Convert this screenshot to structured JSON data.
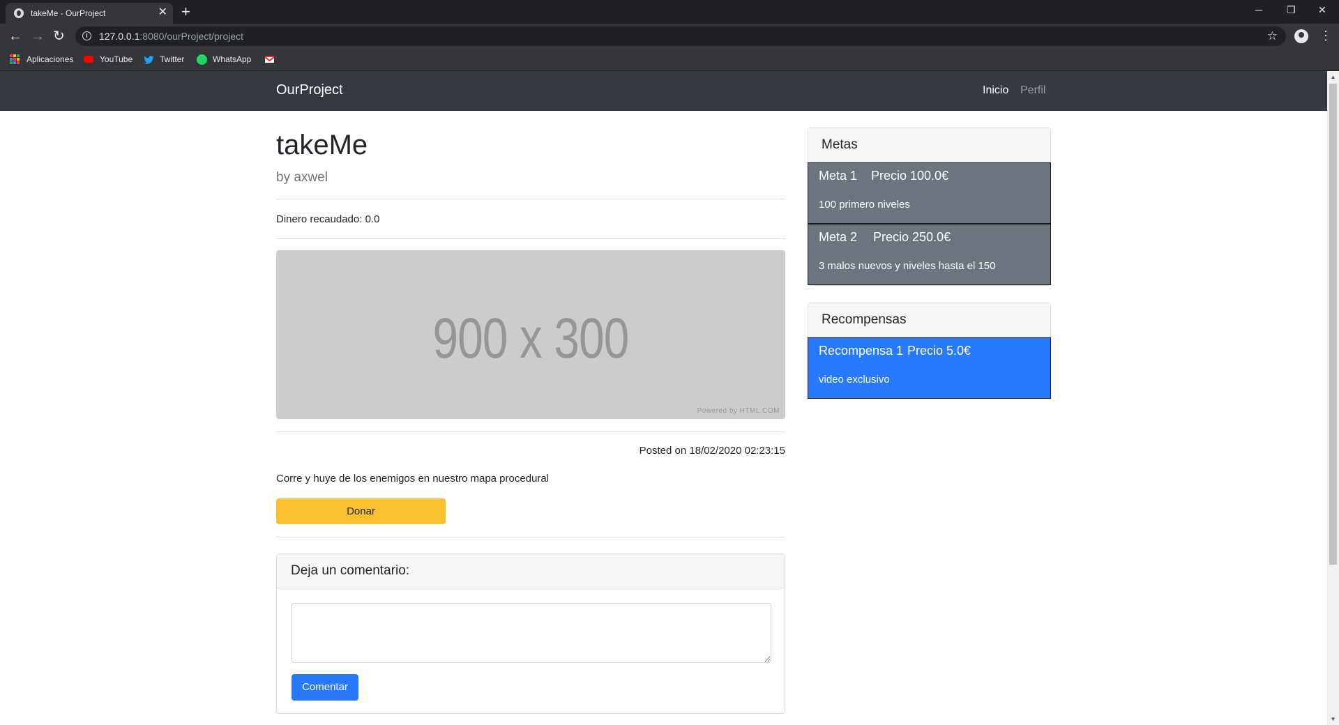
{
  "browser": {
    "tab_title": "takeMe - OurProject",
    "url_host": "127.0.0.1",
    "url_rest": ":8080/ourProject/project",
    "bookmarks": [
      "Aplicaciones",
      "YouTube",
      "Twitter",
      "WhatsApp"
    ]
  },
  "navbar": {
    "brand": "OurProject",
    "links": [
      "Inicio",
      "Perfil"
    ]
  },
  "project": {
    "title": "takeMe",
    "author": "by axwel",
    "raised": "Dinero recaudado: 0.0",
    "image_text": "900 x 300",
    "image_credit": "Powered by HTML.COM",
    "posted": "Posted on 18/02/2020 02:23:15",
    "description": "Corre y huye de los enemigos en nuestro mapa procedural",
    "donate_label": "Donar"
  },
  "comment": {
    "header": "Deja un comentario:",
    "value": "",
    "button_label": "Comentar"
  },
  "metas": {
    "header": "Metas",
    "items": [
      {
        "name": "Meta 1",
        "price": "Precio 100.0€",
        "desc": "100 primero niveles"
      },
      {
        "name": "Meta 2",
        "price": "Precio 250.0€",
        "desc": "3 malos nuevos y niveles hasta el 150"
      }
    ]
  },
  "recompensas": {
    "header": "Recompensas",
    "items": [
      {
        "name": "Recompensa 1",
        "price": "Precio 5.0€",
        "desc": "video exclusivo"
      }
    ]
  },
  "colors": {
    "navbar_bg": "#343a40",
    "donate_bg": "#fbc02d",
    "primary": "#2979ff",
    "meta_bg": "#6c757d",
    "chrome_dark": "#202124",
    "chrome_toolbar": "#35363a"
  },
  "icons": [
    "globe-icon",
    "close-icon",
    "plus-icon",
    "minimize-icon",
    "restore-icon",
    "back-icon",
    "forward-icon",
    "reload-icon",
    "info-icon",
    "star-icon",
    "profile-icon",
    "kebab-icon",
    "apps-icon",
    "youtube-icon",
    "twitter-icon",
    "whatsapp-icon",
    "gmail-icon"
  ]
}
